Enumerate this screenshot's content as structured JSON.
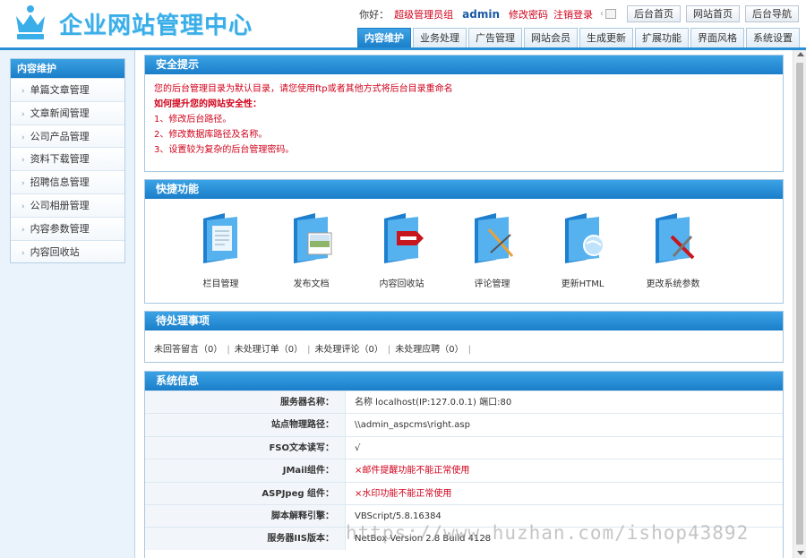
{
  "brand": {
    "title": "企业网站管理中心",
    "accent": "#1a7ec9",
    "logo_color": "#3aaee8"
  },
  "topbar": {
    "greeting": "你好：",
    "role": "超级管理员组",
    "username": "admin",
    "change_password": "修改密码",
    "logout": "注销登录",
    "buttons": [
      "后台首页",
      "网站首页",
      "后台导航"
    ]
  },
  "tabs": [
    "内容维护",
    "业务处理",
    "广告管理",
    "网站会员",
    "生成更新",
    "扩展功能",
    "界面风格",
    "系统设置"
  ],
  "sidebar": {
    "title": "内容维护",
    "items": [
      "单篇文章管理",
      "文章新闻管理",
      "公司产品管理",
      "资料下载管理",
      "招聘信息管理",
      "公司相册管理",
      "内容参数管理",
      "内容回收站"
    ]
  },
  "security": {
    "title": "安全提示",
    "line1": "您的后台管理目录为默认目录，请您使用ftp或者其他方式将后台目录重命名",
    "subtitle": "如何提升您的网站安全性：",
    "tips": [
      "1、修改后台路径。",
      "2、修改数据库路径及名称。",
      "3、设置较为复杂的后台管理密码。"
    ]
  },
  "quick": {
    "title": "快捷功能",
    "items": [
      {
        "label": "栏目管理",
        "icon": "folder-doc-icon"
      },
      {
        "label": "发布文档",
        "icon": "folder-image-icon"
      },
      {
        "label": "内容回收站",
        "icon": "folder-delete-icon"
      },
      {
        "label": "评论管理",
        "icon": "folder-edit-icon"
      },
      {
        "label": "更新HTML",
        "icon": "folder-globe-icon"
      },
      {
        "label": "更改系统参数",
        "icon": "folder-tools-icon"
      }
    ]
  },
  "pending": {
    "title": "待处理事项",
    "items": [
      "未回答留言（0）",
      "未处理订单（0）",
      "未处理评论（0）",
      "未处理应聘（0）"
    ]
  },
  "sysinfo": {
    "title": "系统信息",
    "rows": [
      {
        "k": "服务器名称：",
        "v": "名称 localhost(IP:127.0.0.1) 端口:80",
        "red": false
      },
      {
        "k": "站点物理路径：",
        "v": "\\\\admin_aspcms\\right.asp",
        "red": false
      },
      {
        "k": "FSO文本读写：",
        "v": "√",
        "red": false
      },
      {
        "k": "JMail组件：",
        "v": "×邮件提醒功能不能正常使用",
        "red": true
      },
      {
        "k": "ASPJpeg 组件：",
        "v": "×水印功能不能正常使用",
        "red": true
      },
      {
        "k": "脚本解释引擎：",
        "v": "VBScript/5.8.16384",
        "red": false
      },
      {
        "k": "服务器IIS版本：",
        "v": "NetBox Version 2.8 Build 4128",
        "red": false
      }
    ]
  },
  "watermark": "https://www.huzhan.com/ishop43892"
}
